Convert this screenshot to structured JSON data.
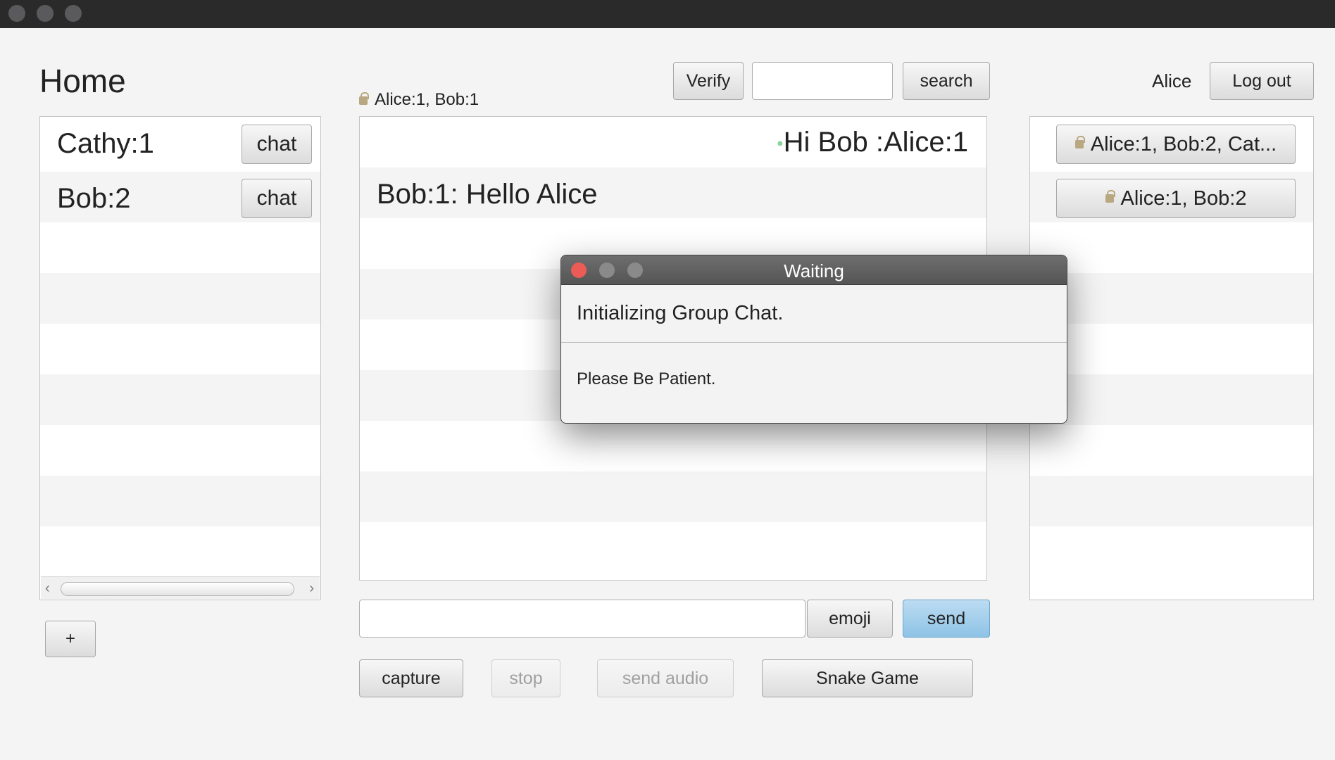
{
  "home": {
    "title": "Home"
  },
  "contacts": {
    "items": [
      {
        "label": "Cathy:1",
        "button": "chat"
      },
      {
        "label": "Bob:2",
        "button": "chat"
      }
    ],
    "add_label": "+"
  },
  "chat": {
    "header": "Alice:1, Bob:1",
    "messages": [
      {
        "text": "Hi Bob :Alice:1"
      },
      {
        "text": "Bob:1: Hello Alice"
      }
    ],
    "verify_label": "Verify",
    "search_value": "",
    "search_label": "search",
    "message_value": "",
    "emoji_label": "emoji",
    "send_label": "send",
    "capture_label": "capture",
    "stop_label": "stop",
    "send_audio_label": "send audio",
    "snake_label": "Snake Game"
  },
  "user": {
    "name": "Alice",
    "logout_label": "Log out"
  },
  "groups": {
    "items": [
      {
        "label": "Alice:1, Bob:2, Cat..."
      },
      {
        "label": "Alice:1, Bob:2"
      }
    ]
  },
  "dialog": {
    "title": "Waiting",
    "header": "Initializing Group Chat.",
    "content": "Please Be Patient."
  },
  "colors": {
    "accent": "#8ec3e6",
    "close": "#ec5b55"
  }
}
